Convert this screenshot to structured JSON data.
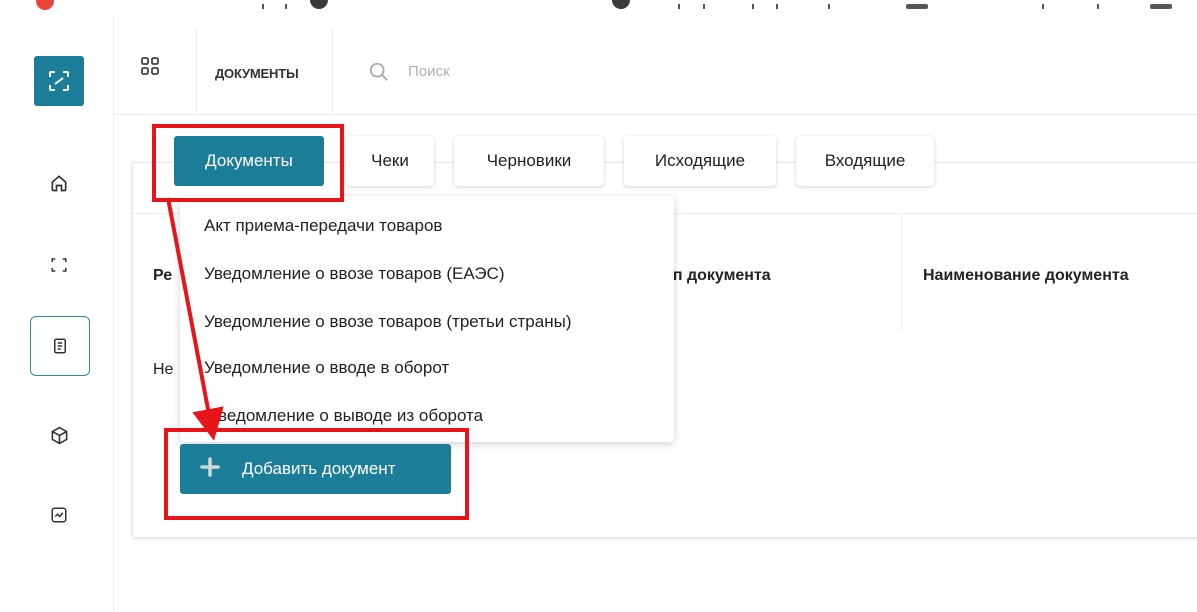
{
  "header": {
    "section_title": "ДОКУМЕНТЫ",
    "search_placeholder": "Поиск"
  },
  "sidebar": {
    "items": [
      {
        "name": "home",
        "icon": "home-icon"
      },
      {
        "name": "scan",
        "icon": "scan-frame-icon"
      },
      {
        "name": "documents",
        "icon": "document-icon",
        "active": true
      },
      {
        "name": "products",
        "icon": "box-icon"
      },
      {
        "name": "reports",
        "icon": "chart-icon"
      }
    ]
  },
  "tabs": [
    {
      "label": "Документы",
      "active": true
    },
    {
      "label": "Чеки"
    },
    {
      "label": "Черновики"
    },
    {
      "label": "Исходящие"
    },
    {
      "label": "Входящие"
    }
  ],
  "table": {
    "columns": [
      "Ре",
      "ип документа",
      "Наименование документа"
    ],
    "empty_text": "Не"
  },
  "dropdown": {
    "items": [
      "Акт приема-передачи товаров",
      "Уведомление о ввозе товаров (ЕАЭС)",
      "Уведомление о ввозе товаров (третьи страны)",
      "Уведомление о вводе в оборот",
      "ведомление о выводе из оборота"
    ]
  },
  "add_button": {
    "label": "Добавить документ"
  },
  "colors": {
    "accent": "#1b7d98",
    "highlight": "#e8131b"
  }
}
